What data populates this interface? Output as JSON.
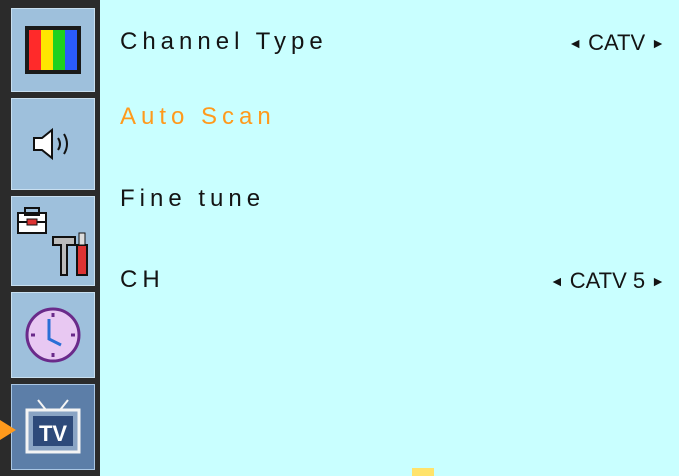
{
  "sidebar": {
    "items": [
      {
        "icon": "color-bars-icon"
      },
      {
        "icon": "speaker-icon"
      },
      {
        "icon": "toolbox-icon"
      },
      {
        "icon": "clock-icon"
      },
      {
        "icon": "tv-icon",
        "label": "TV",
        "active": true
      }
    ]
  },
  "menu": {
    "items": [
      {
        "label": "Channel Type",
        "value": "CATV",
        "left_arrow": "◄",
        "right_arrow": "►"
      },
      {
        "label": "Auto Scan",
        "highlighted": true
      },
      {
        "label": "Fine tune"
      },
      {
        "label": "CH",
        "value": "CATV 5",
        "left_arrow": "◄",
        "right_arrow": "►"
      }
    ]
  },
  "colors": {
    "background": "#c9ffff",
    "highlight": "#ff9a1c",
    "sidebar": "#9ec0dc",
    "sidebar_active": "#5c7ea8"
  }
}
